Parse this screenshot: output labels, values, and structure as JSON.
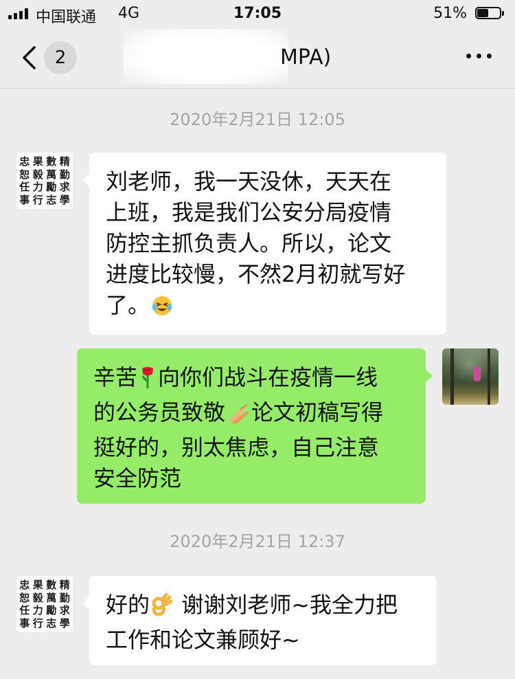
{
  "status_bar": {
    "carrier": "中国联通",
    "network": "4G",
    "time": "17:05",
    "battery_percent": "51%",
    "battery_level": 0.51
  },
  "nav": {
    "back_icon": "chevron-left-icon",
    "unread_count": "2",
    "title_visible_fragment": "MPA)",
    "more_icon": "ellipsis-icon"
  },
  "colors": {
    "background": "#ededed",
    "incoming_bubble": "#ffffff",
    "outgoing_bubble": "#95ec69",
    "timestamp_text": "#a4a4a4"
  },
  "avatar_calligraphy_chars": [
    "忠",
    "果",
    "數",
    "精",
    "恕",
    "毅",
    "萬",
    "勤",
    "任",
    "力",
    "勵",
    "求",
    "事",
    "行",
    "志",
    "學"
  ],
  "messages": {
    "timestamp_1": "2020年2月21日 12:05",
    "msg_1": "刘老师，我一天没休，天天在\n上班，我是我们公安分局疫情\n防控主抓负责人。所以，论文\n进度比较慢，不然2月初就写好\n了。",
    "msg_1_emoji": "tears-of-joy-icon",
    "msg_2_part_1": "辛苦",
    "msg_2_part_2": "向你们战斗在疫情一线\n的公务员致敬",
    "msg_2_part_3": "论文初稿写得\n挺好的，别太焦虑，自己注意\n安全防范",
    "msg_2_emoji_1": "rose-icon",
    "msg_2_emoji_2": "folded-hands-icon",
    "timestamp_2": "2020年2月21日 12:37",
    "msg_3_part_1": "好的",
    "msg_3_part_2": " 谢谢刘老师~我全力把\n工作和论文兼顾好~",
    "msg_3_emoji": "ok-hand-icon"
  }
}
